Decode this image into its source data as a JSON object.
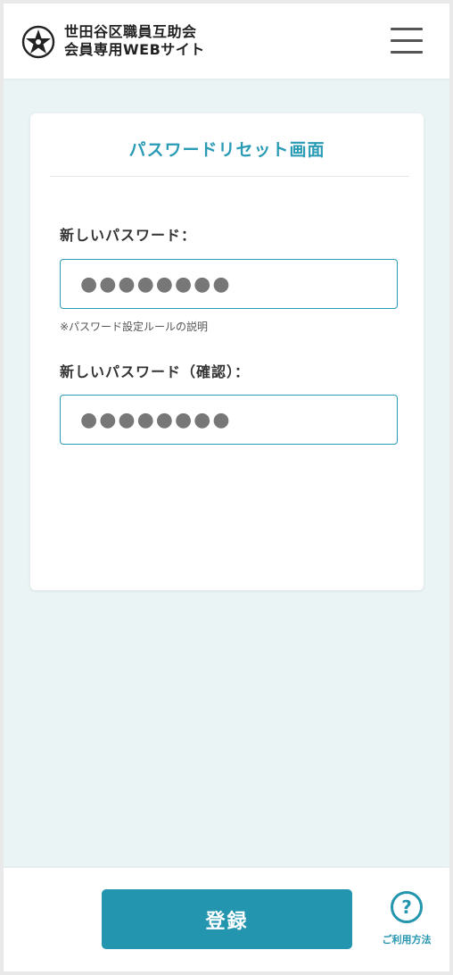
{
  "header": {
    "brand_line1": "世田谷区職員互助会",
    "brand_line2": "会員専用WEBサイト",
    "logo_icon": "star-emblem-icon",
    "menu_icon": "hamburger-menu-icon"
  },
  "card": {
    "title": "パスワードリセット画面",
    "new_password_label": "新しいパスワード：",
    "new_password_value": "●●●●●●●●",
    "password_rule_hint": "※パスワード設定ルールの説明",
    "confirm_password_label": "新しいパスワード（確認）：",
    "confirm_password_value": "●●●●●●●●"
  },
  "footer": {
    "submit_label": "登録",
    "help_icon_glyph": "?",
    "help_label": "ご利用方法"
  },
  "colors": {
    "accent": "#2395ae",
    "title": "#2a9bb5",
    "background": "#ebf4f5"
  }
}
